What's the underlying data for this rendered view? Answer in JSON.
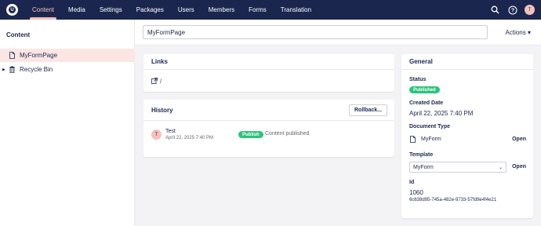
{
  "topbar": {
    "logo": "umbraco-logo",
    "nav": [
      "Content",
      "Media",
      "Settings",
      "Packages",
      "Users",
      "Members",
      "Forms",
      "Translation"
    ],
    "active": "Content",
    "user_initial": "T"
  },
  "sidebar": {
    "title": "Content",
    "items": [
      {
        "label": "MyFormPage",
        "icon": "document-icon",
        "selected": true
      },
      {
        "label": "Recycle Bin",
        "icon": "trash-icon",
        "selected": false
      }
    ]
  },
  "header": {
    "name_value": "MyFormPage",
    "actions_label": "Actions"
  },
  "links": {
    "title": "Links",
    "url": "/"
  },
  "history": {
    "title": "History",
    "rollback_label": "Rollback...",
    "entry": {
      "initial": "T",
      "name": "Test",
      "date": "April 22, 2025 7:40 PM",
      "badge": "Publish",
      "message": "Content published"
    }
  },
  "general": {
    "title": "General",
    "status_label": "Status",
    "status_value": "Published",
    "created_label": "Created Date",
    "created_value": "April 22, 2025 7:40 PM",
    "doctype_label": "Document Type",
    "doctype_value": "MyForm",
    "open_label": "Open",
    "template_label": "Template",
    "template_value": "MyForm",
    "id_label": "Id",
    "id_value": "1060",
    "guid_value": "6c638d95-745a-482e-9733-57fd9e4f4e21"
  },
  "colors": {
    "topbar": "#1b264f",
    "accent": "#f5c1bc",
    "published": "#2bc37c",
    "selected_bg": "#fce6e4"
  }
}
